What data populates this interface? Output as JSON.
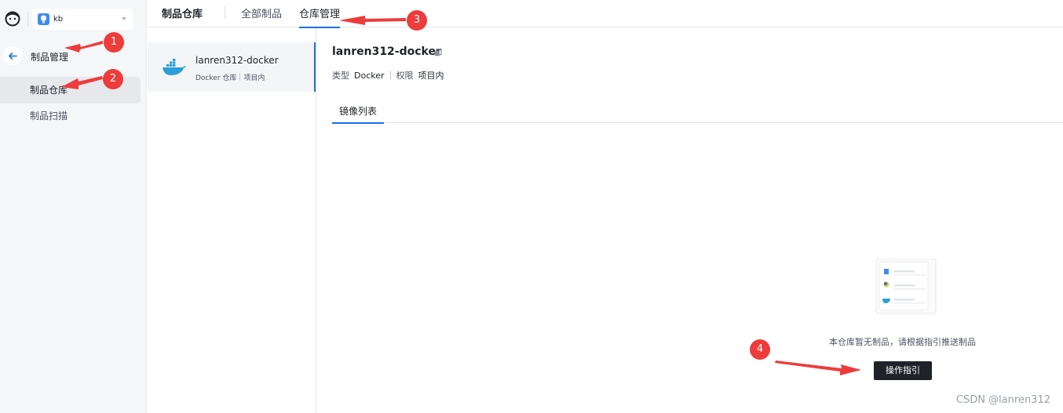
{
  "sidebar": {
    "project": {
      "name": "kb"
    },
    "section_title": "制品管理",
    "items": [
      {
        "label": "制品仓库",
        "active": true
      },
      {
        "label": "制品扫描",
        "active": false
      }
    ]
  },
  "header": {
    "title": "制品仓库",
    "tabs": [
      {
        "label": "全部制品",
        "active": false
      },
      {
        "label": "仓库管理",
        "active": true
      }
    ]
  },
  "repo_list": [
    {
      "name": "lanren312-docker",
      "type": "Docker 仓库",
      "permission": "项目内"
    }
  ],
  "detail": {
    "title": "lanren312-docker",
    "type_label": "类型",
    "type_value": "Docker",
    "permission_label": "权限",
    "permission_value": "项目内",
    "subtab": "镜像列表",
    "empty_text": "本仓库暂无制品，请根据指引推送制品",
    "guide_button": "操作指引"
  },
  "annotations": [
    "1",
    "2",
    "3",
    "4"
  ],
  "watermark": "CSDN @lanren312",
  "colors": {
    "accent": "#1a6fe8",
    "annotation_red": "#ee3b3b",
    "dark_button": "#1f2329",
    "sidebar_bg": "#f5f6f8"
  }
}
